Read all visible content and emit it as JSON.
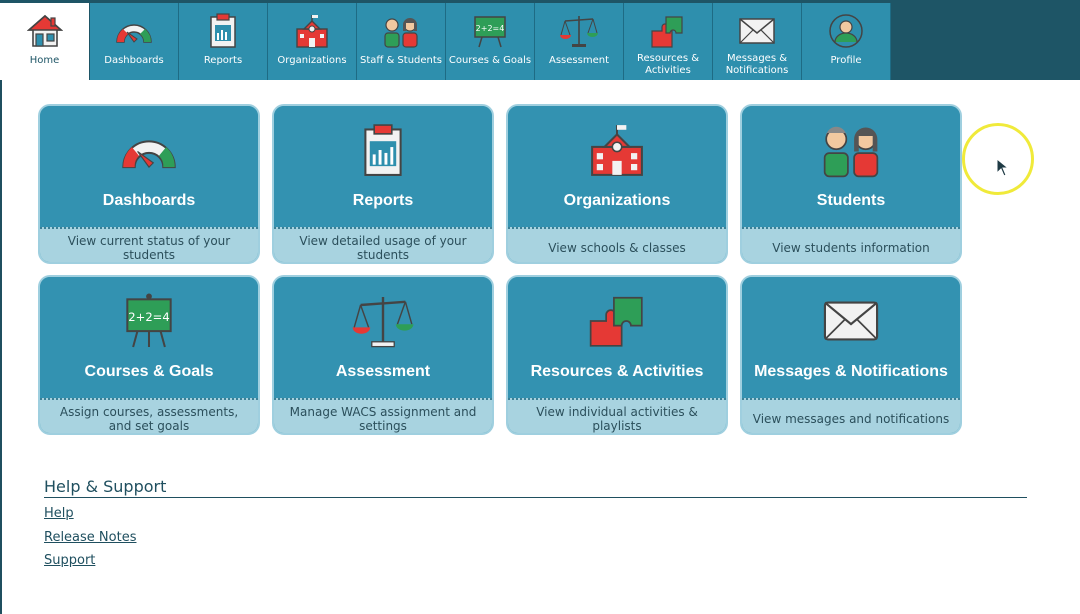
{
  "nav": {
    "tabs": [
      {
        "id": "home",
        "label": "Home",
        "icon": "house-icon",
        "active": true
      },
      {
        "id": "dashboards",
        "label": "Dashboards",
        "icon": "gauge-icon"
      },
      {
        "id": "reports",
        "label": "Reports",
        "icon": "clipboard-chart-icon"
      },
      {
        "id": "organizations",
        "label": "Organizations",
        "icon": "school-icon"
      },
      {
        "id": "staff-students",
        "label": "Staff & Students",
        "icon": "people-icon"
      },
      {
        "id": "courses-goals",
        "label": "Courses & Goals",
        "icon": "chalkboard-icon"
      },
      {
        "id": "assessment",
        "label": "Assessment",
        "icon": "scale-icon"
      },
      {
        "id": "resources-activities",
        "label": "Resources &\nActivities",
        "icon": "puzzle-icon"
      },
      {
        "id": "messages-notifications",
        "label": "Messages &\nNotifications",
        "icon": "envelope-icon"
      },
      {
        "id": "profile",
        "label": "Profile",
        "icon": "user-circle-icon"
      }
    ]
  },
  "tiles": [
    {
      "title": "Dashboards",
      "desc": "View current status of your students",
      "icon": "gauge-icon"
    },
    {
      "title": "Reports",
      "desc": "View detailed usage of your students",
      "icon": "clipboard-chart-icon"
    },
    {
      "title": "Organizations",
      "desc": "View schools & classes",
      "icon": "school-icon"
    },
    {
      "title": "Students",
      "desc": "View students information",
      "icon": "people-icon"
    },
    {
      "title": "Courses & Goals",
      "desc": "Assign courses, assessments, and set goals",
      "icon": "chalkboard-icon"
    },
    {
      "title": "Assessment",
      "desc": "Manage WACS assignment and settings",
      "icon": "scale-icon"
    },
    {
      "title": "Resources & Activities",
      "desc": "View individual activities & playlists",
      "icon": "puzzle-icon"
    },
    {
      "title": "Messages & Notifications",
      "desc": "View messages and notifications",
      "icon": "envelope-icon"
    }
  ],
  "help": {
    "title": "Help & Support",
    "links": [
      "Help",
      "Release Notes",
      "Support"
    ]
  },
  "icon_text": {
    "chalkboard": "2+2=4"
  },
  "colors": {
    "nav_bg": "#1e5566",
    "tab_bg": "#2e8fad",
    "tile_bg": "#3392b1",
    "tile_desc_bg": "#a8d3e0",
    "accent_red": "#e53935",
    "accent_green": "#2e9e57",
    "cursor_ring": "#f0ea3a"
  }
}
